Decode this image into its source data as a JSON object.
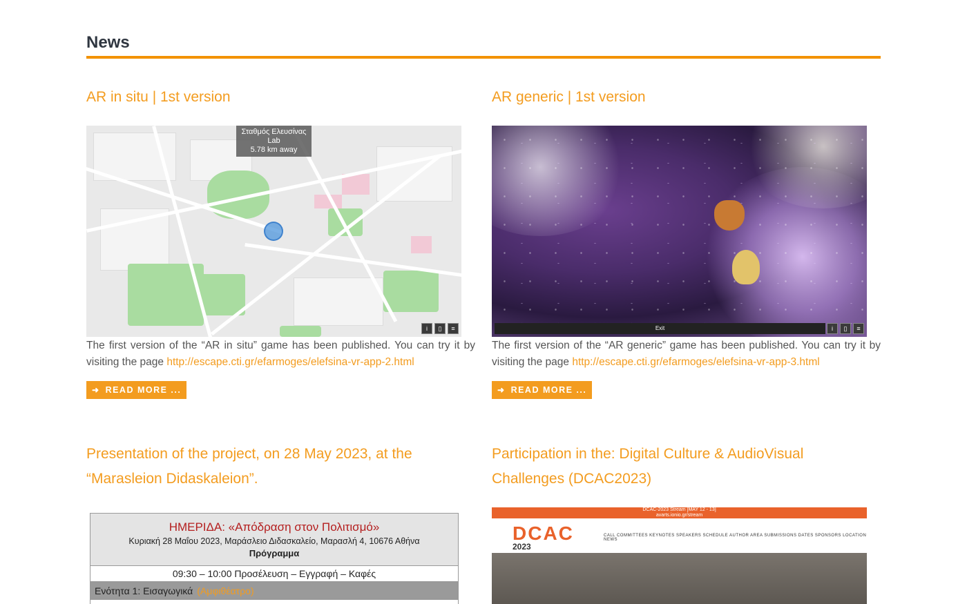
{
  "section": {
    "title": "News"
  },
  "read_more_label": "READ MORE ...",
  "accent_color": "#f39c1f",
  "posts": [
    {
      "title": "AR in situ | 1st version",
      "excerpt_text": "The first version of the “AR in situ” game has been published. You can try it by visiting the page ",
      "link": "http://escape.cti.gr/efarmoges/elefsina-vr-app-2.html",
      "map_label": {
        "line1": "Σταθμός Ελευσίνας",
        "line2": "Lab",
        "line3": "5.78 km away"
      }
    },
    {
      "title": "AR generic | 1st version",
      "excerpt_text": "The first version of the “AR generic” game has been published. You can try it by visiting the page ",
      "link": "http://escape.cti.gr/efarmoges/elefsina-vr-app-3.html",
      "exit_label": "Exit"
    },
    {
      "title": "Presentation of the project, on 28 May 2023, at the “Marasleion Didaskaleion”.",
      "program": {
        "heading": "ΗΜΕΡΙΔΑ: «Απόδραση στον Πολιτισμό»",
        "date_line": "Κυριακή 28 Μαΐου 2023, Μαράσλειο Διδασκαλείο, Μαρασλή 4, 10676 Αθήνα",
        "programme": "Πρόγραμμα",
        "slot": "09:30 – 10:00 Προσέλευση – Εγγραφή – Καφές",
        "unit": "Ενότητα 1: Εισαγωγικά",
        "unit_place": "(Αμφιθέατρο)"
      }
    },
    {
      "title": "Participation in the: Digital Culture & AudioVisual Challenges (DCAC2023)",
      "dcac": {
        "stream_line1": "DCAC-2023 Stream [MAY 12 - 13]",
        "stream_line2": "avarts.ionio.gr/stream",
        "logo": "DCAC",
        "year": "2023",
        "menu": "CALL   COMMITTEES   KEYNOTES   SPEAKERS   SCHEDULE   AUTHOR AREA   SUBMISSIONS   DATES   SPONSORS   LOCATION   NEWS"
      }
    }
  ]
}
